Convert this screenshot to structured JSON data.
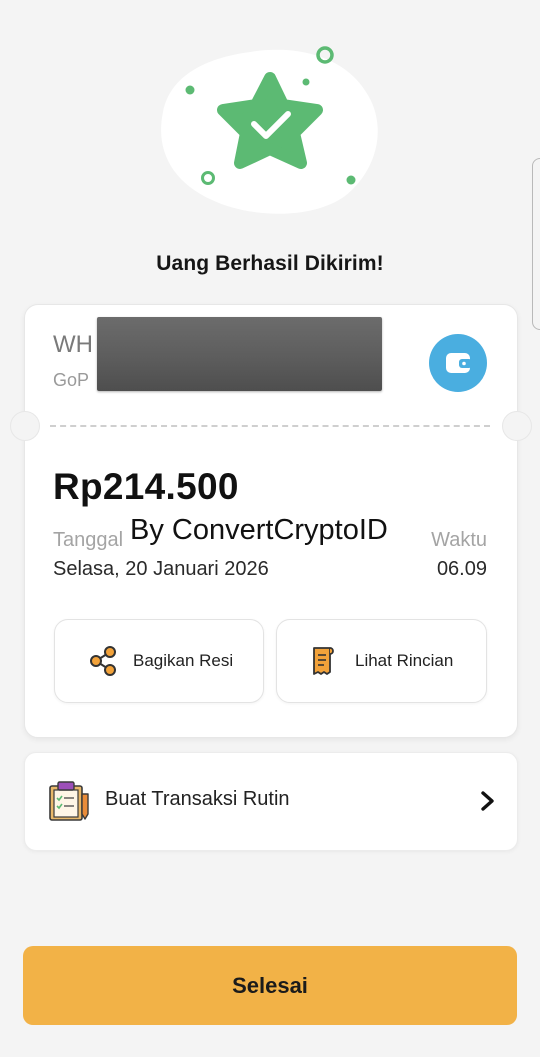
{
  "status": {
    "title": "Uang Berhasil Dikirim!",
    "hero_icon": "star-check-icon",
    "accent_color": "#5cba73"
  },
  "receipt": {
    "recipient_name": "WH",
    "recipient_account": "GoP",
    "wallet_icon": "wallet-icon",
    "amount": "Rp214.500",
    "date_label": "Tanggal",
    "date_value": "Selasa, 20 Januari 2026",
    "time_label": "Waktu",
    "time_value": "06.09",
    "watermark": "By ConvertCryptoID"
  },
  "actions": {
    "share_label": "Bagikan Resi",
    "share_icon": "share-icon",
    "detail_label": "Lihat Rincian",
    "detail_icon": "receipt-icon"
  },
  "routine": {
    "label": "Buat Transaksi Rutin",
    "icon": "clipboard-icon"
  },
  "footer": {
    "done_label": "Selesai",
    "button_color": "#f2b247"
  }
}
